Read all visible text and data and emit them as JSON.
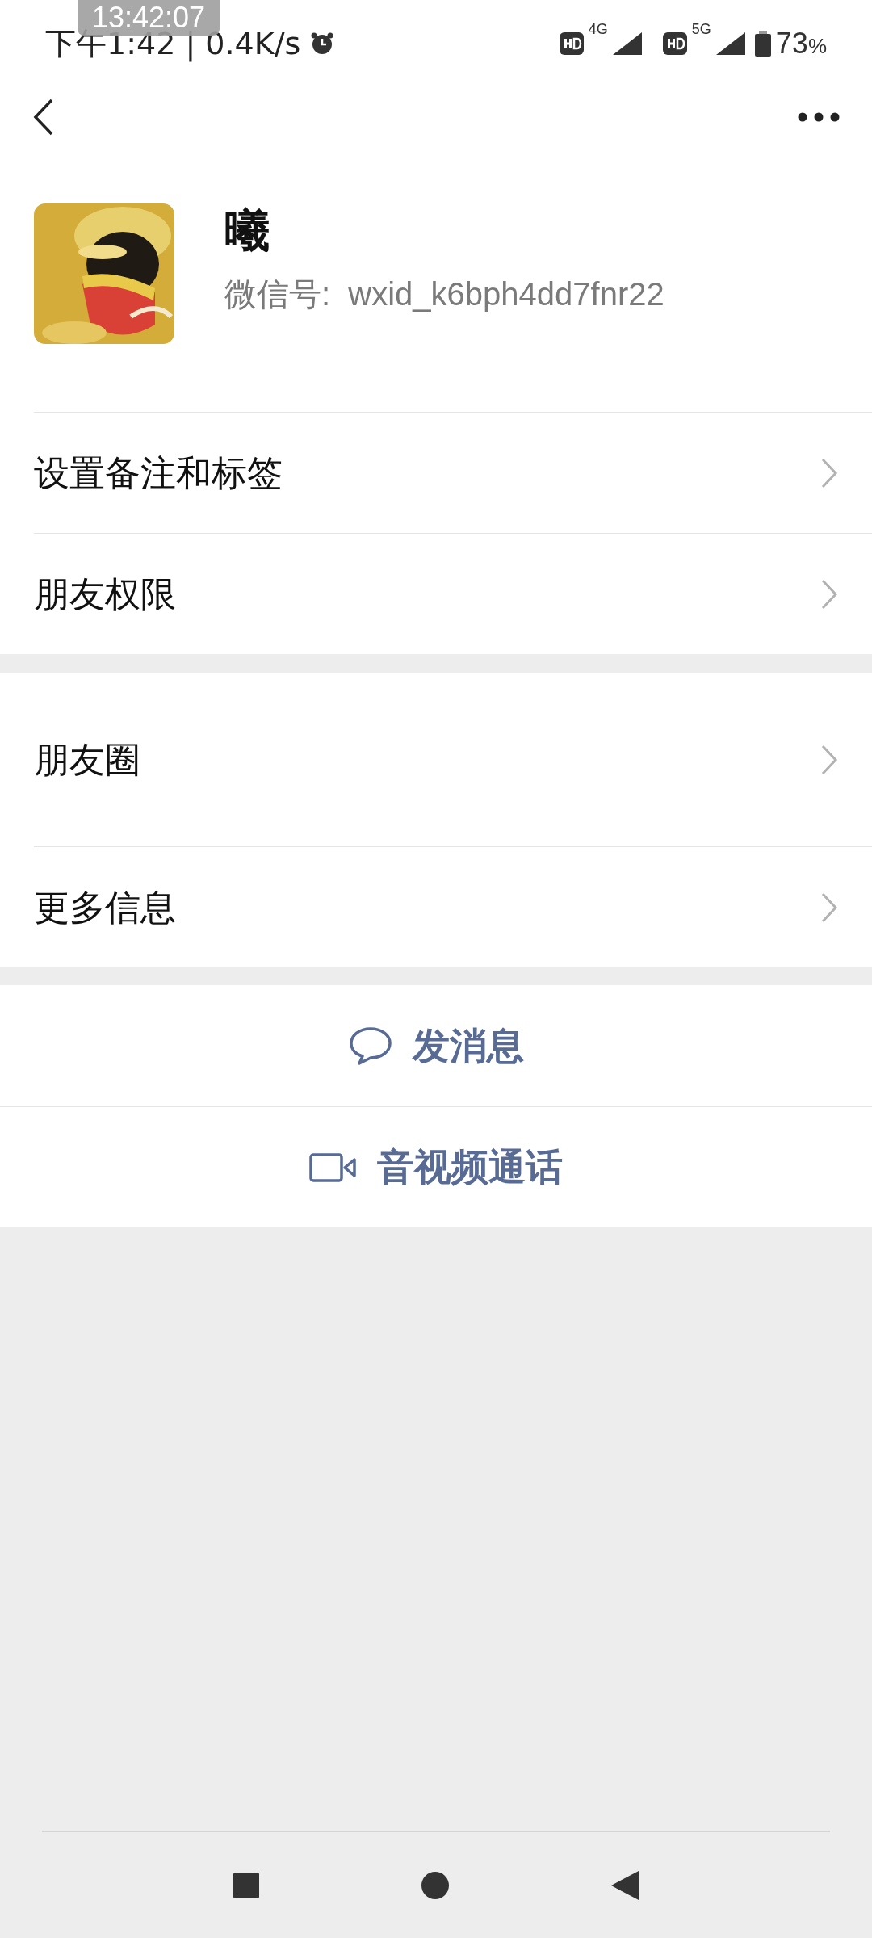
{
  "overlay_clock": "13:42:07",
  "status_bar": {
    "left": "下午1:42 | 0.4K/s",
    "battery": "73",
    "battery_unit": "%",
    "net_1": "4G",
    "net_2": "5G"
  },
  "profile": {
    "name": "曦",
    "wechat_id": "微信号:  wxid_k6bph4dd7fnr22"
  },
  "groups": [
    [
      {
        "label": "设置备注和标签"
      },
      {
        "label": "朋友权限"
      }
    ],
    [
      {
        "label": "朋友圈",
        "kind": "tall"
      },
      {
        "label": "更多信息"
      }
    ]
  ],
  "actions": [
    {
      "label": "发消息",
      "kind": "message"
    },
    {
      "label": "音视频通话",
      "kind": "video"
    }
  ]
}
